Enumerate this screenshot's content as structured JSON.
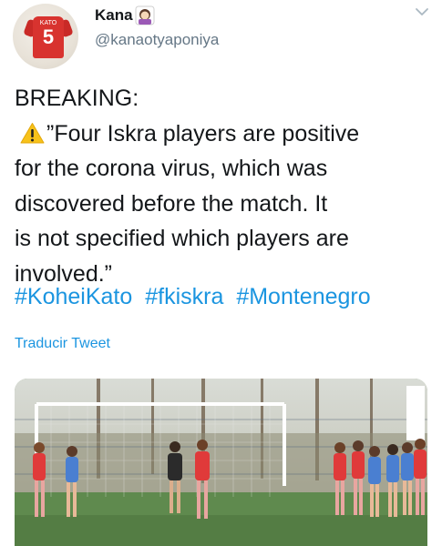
{
  "author": {
    "display_name": "Kana",
    "handle": "@kanaotyaponiya",
    "avatar_jersey_name": "KATO",
    "avatar_jersey_number": "5"
  },
  "tweet": {
    "lines": [
      "BREAKING:",
      "”Four Iskra players are positive",
      "for the corona virus, which was",
      "discovered before the match. It",
      "is not specified which players are",
      "involved.”"
    ],
    "hashtags": [
      "#KoheiKato",
      "#fkiskra",
      "#Montenegro"
    ]
  },
  "translate_label": "Traducir Tweet",
  "icons": {
    "name_emoji": "woman-emoji-icon",
    "warning": "warning-icon",
    "menu": "chevron-down-icon"
  },
  "colors": {
    "link": "#1b95e0",
    "text": "#14171a",
    "secondary": "#657786",
    "jersey": "#d8332f"
  }
}
